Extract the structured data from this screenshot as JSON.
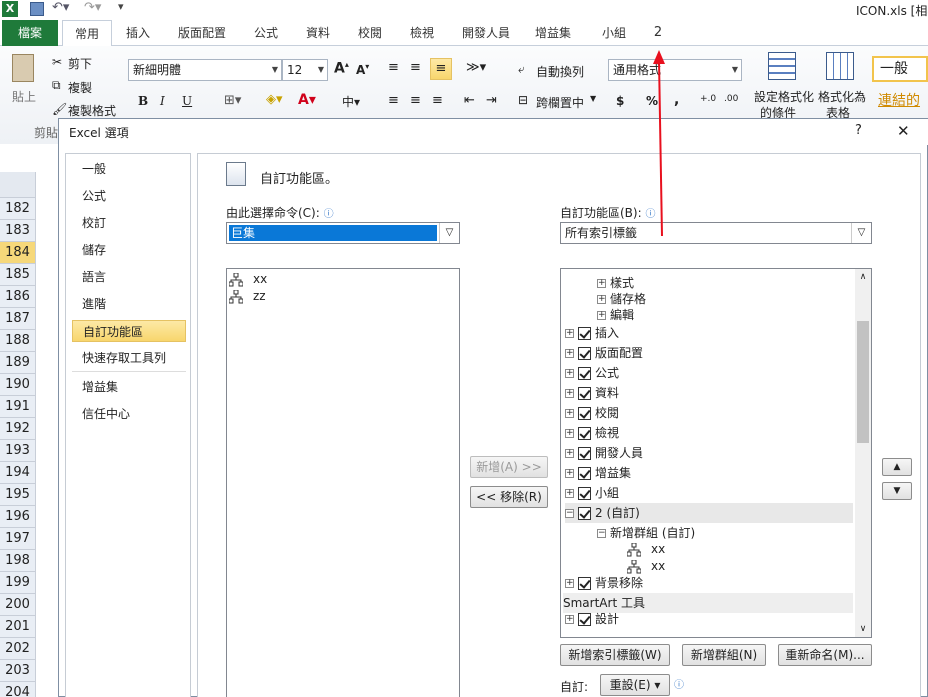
{
  "titlebar": {
    "filename": "ICON.xls [相容"
  },
  "tabs": [
    {
      "label": "檔案"
    },
    {
      "label": "常用"
    },
    {
      "label": "插入"
    },
    {
      "label": "版面配置"
    },
    {
      "label": "公式"
    },
    {
      "label": "資料"
    },
    {
      "label": "校閱"
    },
    {
      "label": "檢視"
    },
    {
      "label": "開發人員"
    },
    {
      "label": "增益集"
    },
    {
      "label": "小組"
    },
    {
      "label": "2"
    }
  ],
  "ribbon": {
    "paste": "貼上",
    "cut": "剪下",
    "copy": "複製",
    "format_painter": "複製格式",
    "clipboard_group": "剪貼",
    "font_name": "新細明體",
    "font_size": "12",
    "bold": "B",
    "italic": "I",
    "underline": "U",
    "wrap_text": "自動換列",
    "merge_center": "跨欄置中",
    "number_format": "通用格式",
    "currency": "$",
    "percent": "%",
    "comma": ",",
    "conditional_format_1": "設定格式化",
    "conditional_format_2": "的條件",
    "format_table_1": "格式化為",
    "format_table_2": "表格",
    "style_normal": "一般",
    "style_link": "連結的"
  },
  "rows": [
    "182",
    "183",
    "184",
    "185",
    "186",
    "187",
    "188",
    "189",
    "190",
    "191",
    "192",
    "193",
    "194",
    "195",
    "196",
    "197",
    "198",
    "199",
    "200",
    "201",
    "202",
    "203",
    "204"
  ],
  "dialog": {
    "title": "Excel 選項",
    "help": "?",
    "close": "✕",
    "nav": [
      {
        "label": "一般"
      },
      {
        "label": "公式"
      },
      {
        "label": "校訂"
      },
      {
        "label": "儲存"
      },
      {
        "label": "語言"
      },
      {
        "label": "進階"
      },
      {
        "label": "自訂功能區"
      },
      {
        "label": "快速存取工具列"
      },
      {
        "label": "增益集"
      },
      {
        "label": "信任中心"
      }
    ],
    "heading": "自訂功能區。",
    "choose_label": "由此選擇命令(C):",
    "choose_value": "巨集",
    "customize_label": "自訂功能區(B):",
    "customize_value": "所有索引標籤",
    "left_list": [
      {
        "label": "xx"
      },
      {
        "label": "zz"
      }
    ],
    "add_button": "新增(A) >>",
    "remove_button": "<< 移除(R)",
    "tree": {
      "top_sub": [
        {
          "label": "樣式"
        },
        {
          "label": "儲存格"
        },
        {
          "label": "編輯"
        }
      ],
      "tabs": [
        {
          "label": "插入"
        },
        {
          "label": "版面配置"
        },
        {
          "label": "公式"
        },
        {
          "label": "資料"
        },
        {
          "label": "校閱"
        },
        {
          "label": "檢視"
        },
        {
          "label": "開發人員"
        },
        {
          "label": "增益集"
        },
        {
          "label": "小組"
        }
      ],
      "custom_tab": "2 (自訂)",
      "custom_group": "新增群組 (自訂)",
      "custom_items": [
        {
          "label": "xx"
        },
        {
          "label": "xx"
        }
      ],
      "after_tab": "背景移除",
      "smartart_header": "SmartArt 工具",
      "smartart_design": "設計"
    },
    "new_tab_button": "新增索引標籤(W)",
    "new_group_button": "新增群組(N)",
    "rename_button": "重新命名(M)...",
    "custom_label": "自訂:",
    "reset_button": "重設(E) ▾",
    "up_arrow": "▲",
    "down_arrow": "▼"
  },
  "colors": {
    "accent": "#1f7a3a",
    "selection": "#0a78d7",
    "arrow": "#e8101e"
  }
}
